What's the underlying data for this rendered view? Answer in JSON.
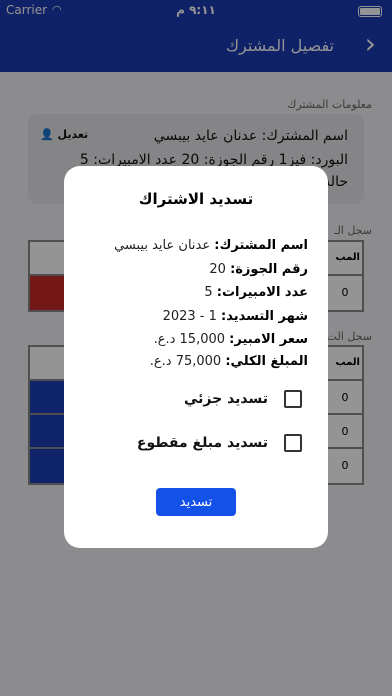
{
  "status_bar": {
    "carrier": "Carrier",
    "time": "٩:١١ م"
  },
  "header": {
    "title": "تفصيل المشترك"
  },
  "background": {
    "info_section_label": "معلومات المشترك",
    "edit_label": "تعديل",
    "subscriber_line": "اسم المشترك: عدنان عايد بيبسي",
    "board_line": "البورد: فيز1    رقم الجوزة: 20    عدد الامبيرات: 5",
    "status_line": "حالة",
    "history_label_1": "سجل الـ",
    "history_label_2": "سجل الت",
    "col_head": "المب",
    "cell_val": "0"
  },
  "modal": {
    "title": "تسديد الاشتراك",
    "rows": [
      {
        "key": "اسم المشترك:",
        "value": "عدنان عايد بيبسي"
      },
      {
        "key": "رقم الجوزة:",
        "value": "20"
      },
      {
        "key": "عدد الامبيرات:",
        "value": "5"
      },
      {
        "key": "شهر التسديد:",
        "value": "1 - 2023"
      },
      {
        "key": "سعر الامبير:",
        "value": "15,000 د.ع."
      },
      {
        "key": "المبلغ الكلي:",
        "value": "75,000 د.ع."
      }
    ],
    "options": [
      {
        "label": "تسديد جزئي"
      },
      {
        "label": "تسديد مبلغ مقطوع"
      }
    ],
    "pay_button": "تسديد"
  }
}
